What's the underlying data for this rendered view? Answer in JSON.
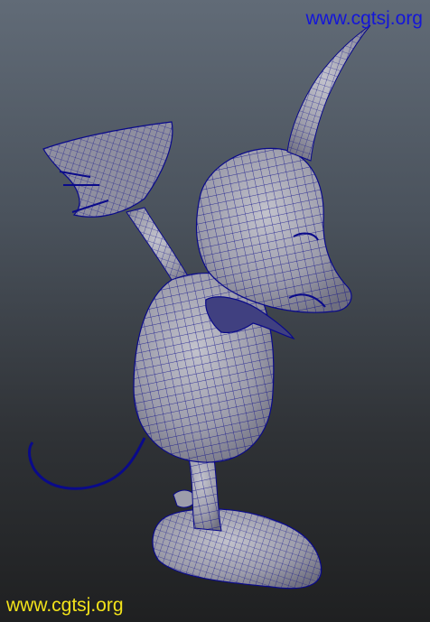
{
  "viewport": {
    "watermark_top": "www.cgtsj.org",
    "watermark_bottom": "www.cgtsj.org",
    "colors": {
      "background_top": "#616b77",
      "background_bottom": "#1f2021",
      "mesh_fill": "#a7a7b3",
      "wireframe": "#0a0a8a",
      "watermark_top": "#1416d8",
      "watermark_bottom": "#f2e21a"
    }
  }
}
